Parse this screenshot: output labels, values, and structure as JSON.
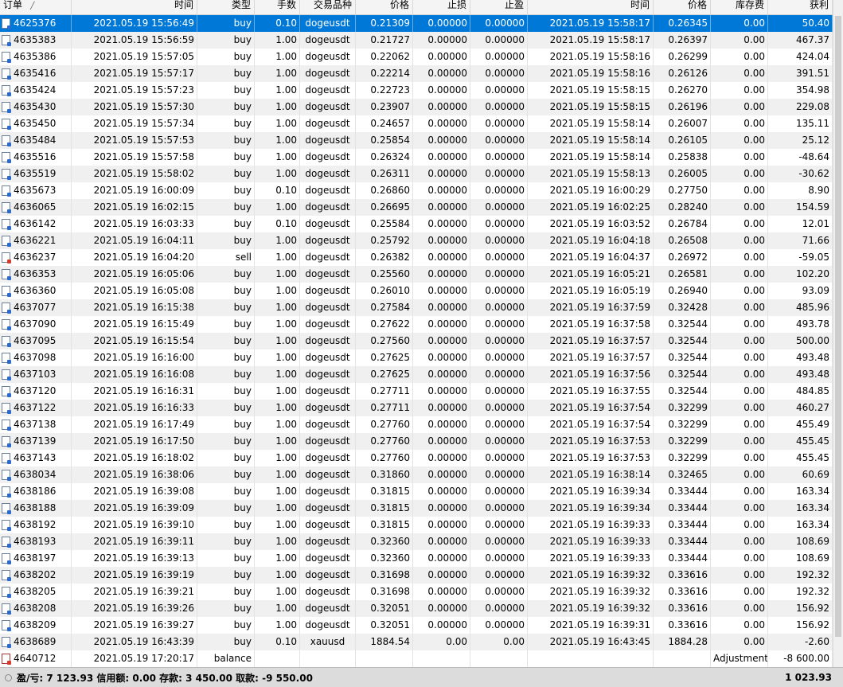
{
  "columns": [
    "订单",
    "时间",
    "类型",
    "手数",
    "交易品种",
    "价格",
    "止损",
    "止盈",
    "时间",
    "价格",
    "库存费",
    "获利"
  ],
  "rows": [
    {
      "order": "4625376",
      "open_time": "2021.05.19 15:56:49",
      "type": "buy",
      "lots": "0.10",
      "symbol": "dogeusdt",
      "open_price": "0.21309",
      "sl": "0.00000",
      "tp": "0.00000",
      "close_time": "2021.05.19 15:58:17",
      "close_price": "0.26345",
      "swap": "0.00",
      "profit": "50.40"
    },
    {
      "order": "4635383",
      "open_time": "2021.05.19 15:56:59",
      "type": "buy",
      "lots": "1.00",
      "symbol": "dogeusdt",
      "open_price": "0.21727",
      "sl": "0.00000",
      "tp": "0.00000",
      "close_time": "2021.05.19 15:58:17",
      "close_price": "0.26397",
      "swap": "0.00",
      "profit": "467.37"
    },
    {
      "order": "4635386",
      "open_time": "2021.05.19 15:57:05",
      "type": "buy",
      "lots": "1.00",
      "symbol": "dogeusdt",
      "open_price": "0.22062",
      "sl": "0.00000",
      "tp": "0.00000",
      "close_time": "2021.05.19 15:58:16",
      "close_price": "0.26299",
      "swap": "0.00",
      "profit": "424.04"
    },
    {
      "order": "4635416",
      "open_time": "2021.05.19 15:57:17",
      "type": "buy",
      "lots": "1.00",
      "symbol": "dogeusdt",
      "open_price": "0.22214",
      "sl": "0.00000",
      "tp": "0.00000",
      "close_time": "2021.05.19 15:58:16",
      "close_price": "0.26126",
      "swap": "0.00",
      "profit": "391.51"
    },
    {
      "order": "4635424",
      "open_time": "2021.05.19 15:57:23",
      "type": "buy",
      "lots": "1.00",
      "symbol": "dogeusdt",
      "open_price": "0.22723",
      "sl": "0.00000",
      "tp": "0.00000",
      "close_time": "2021.05.19 15:58:15",
      "close_price": "0.26270",
      "swap": "0.00",
      "profit": "354.98"
    },
    {
      "order": "4635430",
      "open_time": "2021.05.19 15:57:30",
      "type": "buy",
      "lots": "1.00",
      "symbol": "dogeusdt",
      "open_price": "0.23907",
      "sl": "0.00000",
      "tp": "0.00000",
      "close_time": "2021.05.19 15:58:15",
      "close_price": "0.26196",
      "swap": "0.00",
      "profit": "229.08"
    },
    {
      "order": "4635450",
      "open_time": "2021.05.19 15:57:34",
      "type": "buy",
      "lots": "1.00",
      "symbol": "dogeusdt",
      "open_price": "0.24657",
      "sl": "0.00000",
      "tp": "0.00000",
      "close_time": "2021.05.19 15:58:14",
      "close_price": "0.26007",
      "swap": "0.00",
      "profit": "135.11"
    },
    {
      "order": "4635484",
      "open_time": "2021.05.19 15:57:53",
      "type": "buy",
      "lots": "1.00",
      "symbol": "dogeusdt",
      "open_price": "0.25854",
      "sl": "0.00000",
      "tp": "0.00000",
      "close_time": "2021.05.19 15:58:14",
      "close_price": "0.26105",
      "swap": "0.00",
      "profit": "25.12"
    },
    {
      "order": "4635516",
      "open_time": "2021.05.19 15:57:58",
      "type": "buy",
      "lots": "1.00",
      "symbol": "dogeusdt",
      "open_price": "0.26324",
      "sl": "0.00000",
      "tp": "0.00000",
      "close_time": "2021.05.19 15:58:14",
      "close_price": "0.25838",
      "swap": "0.00",
      "profit": "-48.64"
    },
    {
      "order": "4635519",
      "open_time": "2021.05.19 15:58:02",
      "type": "buy",
      "lots": "1.00",
      "symbol": "dogeusdt",
      "open_price": "0.26311",
      "sl": "0.00000",
      "tp": "0.00000",
      "close_time": "2021.05.19 15:58:13",
      "close_price": "0.26005",
      "swap": "0.00",
      "profit": "-30.62"
    },
    {
      "order": "4635673",
      "open_time": "2021.05.19 16:00:09",
      "type": "buy",
      "lots": "0.10",
      "symbol": "dogeusdt",
      "open_price": "0.26860",
      "sl": "0.00000",
      "tp": "0.00000",
      "close_time": "2021.05.19 16:00:29",
      "close_price": "0.27750",
      "swap": "0.00",
      "profit": "8.90"
    },
    {
      "order": "4636065",
      "open_time": "2021.05.19 16:02:15",
      "type": "buy",
      "lots": "1.00",
      "symbol": "dogeusdt",
      "open_price": "0.26695",
      "sl": "0.00000",
      "tp": "0.00000",
      "close_time": "2021.05.19 16:02:25",
      "close_price": "0.28240",
      "swap": "0.00",
      "profit": "154.59"
    },
    {
      "order": "4636142",
      "open_time": "2021.05.19 16:03:33",
      "type": "buy",
      "lots": "0.10",
      "symbol": "dogeusdt",
      "open_price": "0.25584",
      "sl": "0.00000",
      "tp": "0.00000",
      "close_time": "2021.05.19 16:03:52",
      "close_price": "0.26784",
      "swap": "0.00",
      "profit": "12.01"
    },
    {
      "order": "4636221",
      "open_time": "2021.05.19 16:04:11",
      "type": "buy",
      "lots": "1.00",
      "symbol": "dogeusdt",
      "open_price": "0.25792",
      "sl": "0.00000",
      "tp": "0.00000",
      "close_time": "2021.05.19 16:04:18",
      "close_price": "0.26508",
      "swap": "0.00",
      "profit": "71.66"
    },
    {
      "order": "4636237",
      "open_time": "2021.05.19 16:04:20",
      "type": "sell",
      "lots": "1.00",
      "symbol": "dogeusdt",
      "open_price": "0.26382",
      "sl": "0.00000",
      "tp": "0.00000",
      "close_time": "2021.05.19 16:04:37",
      "close_price": "0.26972",
      "swap": "0.00",
      "profit": "-59.05"
    },
    {
      "order": "4636353",
      "open_time": "2021.05.19 16:05:06",
      "type": "buy",
      "lots": "1.00",
      "symbol": "dogeusdt",
      "open_price": "0.25560",
      "sl": "0.00000",
      "tp": "0.00000",
      "close_time": "2021.05.19 16:05:21",
      "close_price": "0.26581",
      "swap": "0.00",
      "profit": "102.20"
    },
    {
      "order": "4636360",
      "open_time": "2021.05.19 16:05:08",
      "type": "buy",
      "lots": "1.00",
      "symbol": "dogeusdt",
      "open_price": "0.26010",
      "sl": "0.00000",
      "tp": "0.00000",
      "close_time": "2021.05.19 16:05:19",
      "close_price": "0.26940",
      "swap": "0.00",
      "profit": "93.09"
    },
    {
      "order": "4637077",
      "open_time": "2021.05.19 16:15:38",
      "type": "buy",
      "lots": "1.00",
      "symbol": "dogeusdt",
      "open_price": "0.27584",
      "sl": "0.00000",
      "tp": "0.00000",
      "close_time": "2021.05.19 16:37:59",
      "close_price": "0.32428",
      "swap": "0.00",
      "profit": "485.96"
    },
    {
      "order": "4637090",
      "open_time": "2021.05.19 16:15:49",
      "type": "buy",
      "lots": "1.00",
      "symbol": "dogeusdt",
      "open_price": "0.27622",
      "sl": "0.00000",
      "tp": "0.00000",
      "close_time": "2021.05.19 16:37:58",
      "close_price": "0.32544",
      "swap": "0.00",
      "profit": "493.78"
    },
    {
      "order": "4637095",
      "open_time": "2021.05.19 16:15:54",
      "type": "buy",
      "lots": "1.00",
      "symbol": "dogeusdt",
      "open_price": "0.27560",
      "sl": "0.00000",
      "tp": "0.00000",
      "close_time": "2021.05.19 16:37:57",
      "close_price": "0.32544",
      "swap": "0.00",
      "profit": "500.00"
    },
    {
      "order": "4637098",
      "open_time": "2021.05.19 16:16:00",
      "type": "buy",
      "lots": "1.00",
      "symbol": "dogeusdt",
      "open_price": "0.27625",
      "sl": "0.00000",
      "tp": "0.00000",
      "close_time": "2021.05.19 16:37:57",
      "close_price": "0.32544",
      "swap": "0.00",
      "profit": "493.48"
    },
    {
      "order": "4637103",
      "open_time": "2021.05.19 16:16:08",
      "type": "buy",
      "lots": "1.00",
      "symbol": "dogeusdt",
      "open_price": "0.27625",
      "sl": "0.00000",
      "tp": "0.00000",
      "close_time": "2021.05.19 16:37:56",
      "close_price": "0.32544",
      "swap": "0.00",
      "profit": "493.48"
    },
    {
      "order": "4637120",
      "open_time": "2021.05.19 16:16:31",
      "type": "buy",
      "lots": "1.00",
      "symbol": "dogeusdt",
      "open_price": "0.27711",
      "sl": "0.00000",
      "tp": "0.00000",
      "close_time": "2021.05.19 16:37:55",
      "close_price": "0.32544",
      "swap": "0.00",
      "profit": "484.85"
    },
    {
      "order": "4637122",
      "open_time": "2021.05.19 16:16:33",
      "type": "buy",
      "lots": "1.00",
      "symbol": "dogeusdt",
      "open_price": "0.27711",
      "sl": "0.00000",
      "tp": "0.00000",
      "close_time": "2021.05.19 16:37:54",
      "close_price": "0.32299",
      "swap": "0.00",
      "profit": "460.27"
    },
    {
      "order": "4637138",
      "open_time": "2021.05.19 16:17:49",
      "type": "buy",
      "lots": "1.00",
      "symbol": "dogeusdt",
      "open_price": "0.27760",
      "sl": "0.00000",
      "tp": "0.00000",
      "close_time": "2021.05.19 16:37:54",
      "close_price": "0.32299",
      "swap": "0.00",
      "profit": "455.49"
    },
    {
      "order": "4637139",
      "open_time": "2021.05.19 16:17:50",
      "type": "buy",
      "lots": "1.00",
      "symbol": "dogeusdt",
      "open_price": "0.27760",
      "sl": "0.00000",
      "tp": "0.00000",
      "close_time": "2021.05.19 16:37:53",
      "close_price": "0.32299",
      "swap": "0.00",
      "profit": "455.45"
    },
    {
      "order": "4637143",
      "open_time": "2021.05.19 16:18:02",
      "type": "buy",
      "lots": "1.00",
      "symbol": "dogeusdt",
      "open_price": "0.27760",
      "sl": "0.00000",
      "tp": "0.00000",
      "close_time": "2021.05.19 16:37:53",
      "close_price": "0.32299",
      "swap": "0.00",
      "profit": "455.45"
    },
    {
      "order": "4638034",
      "open_time": "2021.05.19 16:38:06",
      "type": "buy",
      "lots": "1.00",
      "symbol": "dogeusdt",
      "open_price": "0.31860",
      "sl": "0.00000",
      "tp": "0.00000",
      "close_time": "2021.05.19 16:38:14",
      "close_price": "0.32465",
      "swap": "0.00",
      "profit": "60.69"
    },
    {
      "order": "4638186",
      "open_time": "2021.05.19 16:39:08",
      "type": "buy",
      "lots": "1.00",
      "symbol": "dogeusdt",
      "open_price": "0.31815",
      "sl": "0.00000",
      "tp": "0.00000",
      "close_time": "2021.05.19 16:39:34",
      "close_price": "0.33444",
      "swap": "0.00",
      "profit": "163.34"
    },
    {
      "order": "4638188",
      "open_time": "2021.05.19 16:39:09",
      "type": "buy",
      "lots": "1.00",
      "symbol": "dogeusdt",
      "open_price": "0.31815",
      "sl": "0.00000",
      "tp": "0.00000",
      "close_time": "2021.05.19 16:39:34",
      "close_price": "0.33444",
      "swap": "0.00",
      "profit": "163.34"
    },
    {
      "order": "4638192",
      "open_time": "2021.05.19 16:39:10",
      "type": "buy",
      "lots": "1.00",
      "symbol": "dogeusdt",
      "open_price": "0.31815",
      "sl": "0.00000",
      "tp": "0.00000",
      "close_time": "2021.05.19 16:39:33",
      "close_price": "0.33444",
      "swap": "0.00",
      "profit": "163.34"
    },
    {
      "order": "4638193",
      "open_time": "2021.05.19 16:39:11",
      "type": "buy",
      "lots": "1.00",
      "symbol": "dogeusdt",
      "open_price": "0.32360",
      "sl": "0.00000",
      "tp": "0.00000",
      "close_time": "2021.05.19 16:39:33",
      "close_price": "0.33444",
      "swap": "0.00",
      "profit": "108.69"
    },
    {
      "order": "4638197",
      "open_time": "2021.05.19 16:39:13",
      "type": "buy",
      "lots": "1.00",
      "symbol": "dogeusdt",
      "open_price": "0.32360",
      "sl": "0.00000",
      "tp": "0.00000",
      "close_time": "2021.05.19 16:39:33",
      "close_price": "0.33444",
      "swap": "0.00",
      "profit": "108.69"
    },
    {
      "order": "4638202",
      "open_time": "2021.05.19 16:39:19",
      "type": "buy",
      "lots": "1.00",
      "symbol": "dogeusdt",
      "open_price": "0.31698",
      "sl": "0.00000",
      "tp": "0.00000",
      "close_time": "2021.05.19 16:39:32",
      "close_price": "0.33616",
      "swap": "0.00",
      "profit": "192.32"
    },
    {
      "order": "4638205",
      "open_time": "2021.05.19 16:39:21",
      "type": "buy",
      "lots": "1.00",
      "symbol": "dogeusdt",
      "open_price": "0.31698",
      "sl": "0.00000",
      "tp": "0.00000",
      "close_time": "2021.05.19 16:39:32",
      "close_price": "0.33616",
      "swap": "0.00",
      "profit": "192.32"
    },
    {
      "order": "4638208",
      "open_time": "2021.05.19 16:39:26",
      "type": "buy",
      "lots": "1.00",
      "symbol": "dogeusdt",
      "open_price": "0.32051",
      "sl": "0.00000",
      "tp": "0.00000",
      "close_time": "2021.05.19 16:39:32",
      "close_price": "0.33616",
      "swap": "0.00",
      "profit": "156.92"
    },
    {
      "order": "4638209",
      "open_time": "2021.05.19 16:39:27",
      "type": "buy",
      "lots": "1.00",
      "symbol": "dogeusdt",
      "open_price": "0.32051",
      "sl": "0.00000",
      "tp": "0.00000",
      "close_time": "2021.05.19 16:39:31",
      "close_price": "0.33616",
      "swap": "0.00",
      "profit": "156.92"
    },
    {
      "order": "4638689",
      "open_time": "2021.05.19 16:43:39",
      "type": "buy",
      "lots": "0.10",
      "symbol": "xauusd",
      "open_price": "1884.54",
      "sl": "0.00",
      "tp": "0.00",
      "close_time": "2021.05.19 16:43:45",
      "close_price": "1884.28",
      "swap": "0.00",
      "profit": "-2.60"
    },
    {
      "order": "4640712",
      "open_time": "2021.05.19 17:20:17",
      "type": "balance",
      "lots": "",
      "symbol": "",
      "open_price": "",
      "sl": "",
      "tp": "",
      "close_time": "",
      "close_price": "",
      "swap": "Adjustment",
      "profit": "-8 600.00"
    }
  ],
  "footer": {
    "summary": "盈/亏: 7 123.93  信用额: 0.00  存款: 3 450.00  取款: -9 550.00",
    "total": "1 023.93"
  },
  "colors": {
    "selected_row": "#0078d7",
    "buy_icon": "#2b6bd1",
    "sell_icon": "#d83a2a"
  },
  "icons": {
    "order_icon": "document-icon",
    "sort_icon": "sort-arrow-icon",
    "footer_icon": "circle-icon"
  }
}
